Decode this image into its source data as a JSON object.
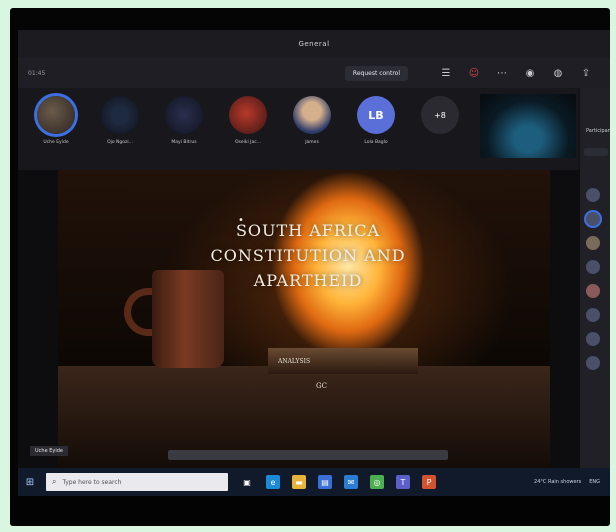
{
  "window": {
    "title": "General"
  },
  "toolbar": {
    "timer": "01:45",
    "request_control": "Request control",
    "icons": [
      "chat-icon",
      "reactions-icon",
      "more-icon",
      "camera-icon",
      "mic-icon",
      "share-icon",
      "leave-icon"
    ]
  },
  "participants": [
    {
      "name": "Uche Eyide",
      "initials": ""
    },
    {
      "name": "Ojo Ngozi...",
      "initials": ""
    },
    {
      "name": "Mayi Bitrus",
      "initials": ""
    },
    {
      "name": "Oseiki Jac...",
      "initials": ""
    },
    {
      "name": "James",
      "initials": ""
    },
    {
      "name": "Lola Baglo",
      "initials": "LB"
    },
    {
      "name": "",
      "initials": "+8"
    }
  ],
  "right_panel": {
    "heading": "Participants"
  },
  "slide": {
    "title": "SOUTH AFRICA CONSTITUTION AND APARTHEID",
    "subtitle": "ANALYSIS",
    "subtitle2": "GC"
  },
  "presenter_tag": "Uche Eyide",
  "taskbar": {
    "search_placeholder": "Type here to search",
    "tray_weather": "24°C Rain showers",
    "tray_lang": "ENG"
  },
  "colors": {
    "accent": "#3d6fe3",
    "teams_purple": "#5b5fc7"
  }
}
